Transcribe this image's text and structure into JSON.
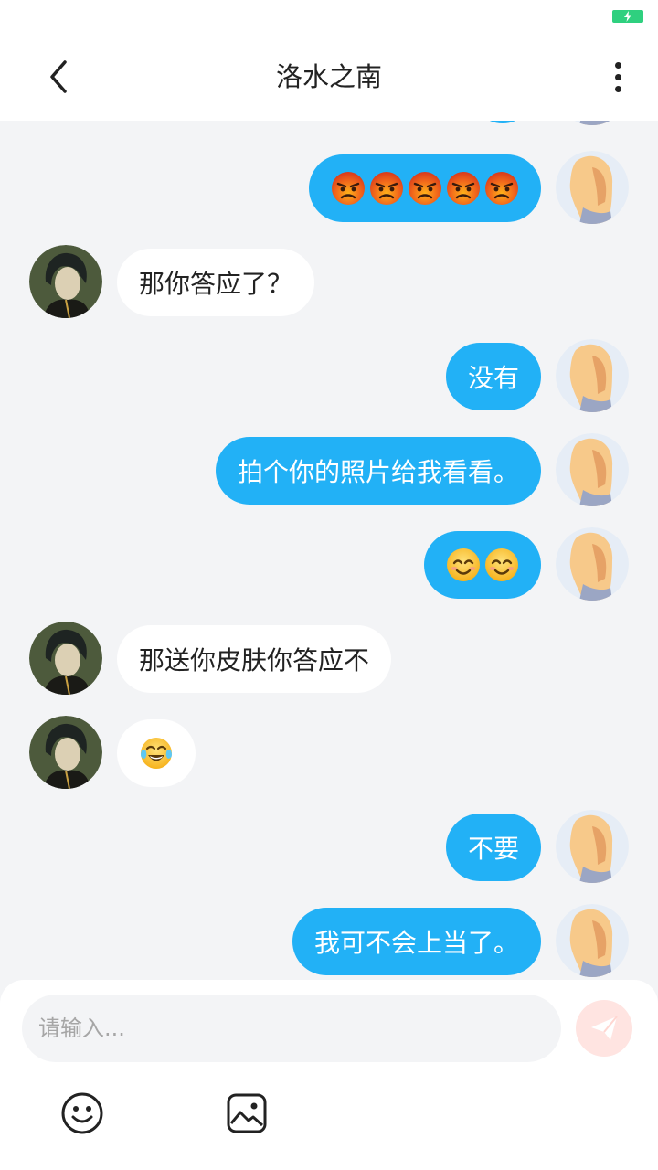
{
  "header": {
    "title": "洛水之南",
    "back_icon": "chevron-left-icon",
    "more_icon": "more-vertical-icon"
  },
  "status_bar": {
    "battery_icon": "battery-charging-icon",
    "battery_color": "#2fd07f"
  },
  "messages": [
    {
      "side": "out",
      "type": "emoji",
      "emoji": "angry-face",
      "count": 5
    },
    {
      "side": "in",
      "type": "text",
      "text": "那你答应了？"
    },
    {
      "side": "out",
      "type": "text",
      "text": "没有"
    },
    {
      "side": "out",
      "type": "text",
      "text": "拍个你的照片给我看看。"
    },
    {
      "side": "out",
      "type": "emoji",
      "emoji": "smiling-face",
      "count": 2
    },
    {
      "side": "in",
      "type": "text",
      "text": "那送你皮肤你答应不"
    },
    {
      "side": "in",
      "type": "emoji",
      "emoji": "tears-of-joy-face",
      "count": 1
    },
    {
      "side": "out",
      "type": "text",
      "text": "不要"
    },
    {
      "side": "out",
      "type": "text",
      "text": "我可不会上当了。"
    }
  ],
  "composer": {
    "input_placeholder": "请输入...",
    "input_value": "",
    "send_icon": "send-icon",
    "emoji_icon": "smiley-icon",
    "image_icon": "image-icon"
  },
  "colors": {
    "outgoing_bubble": "#22b1f6",
    "incoming_bubble": "#ffffff",
    "chat_background": "#f3f4f6",
    "send_button_bg": "#ffe4e1"
  }
}
